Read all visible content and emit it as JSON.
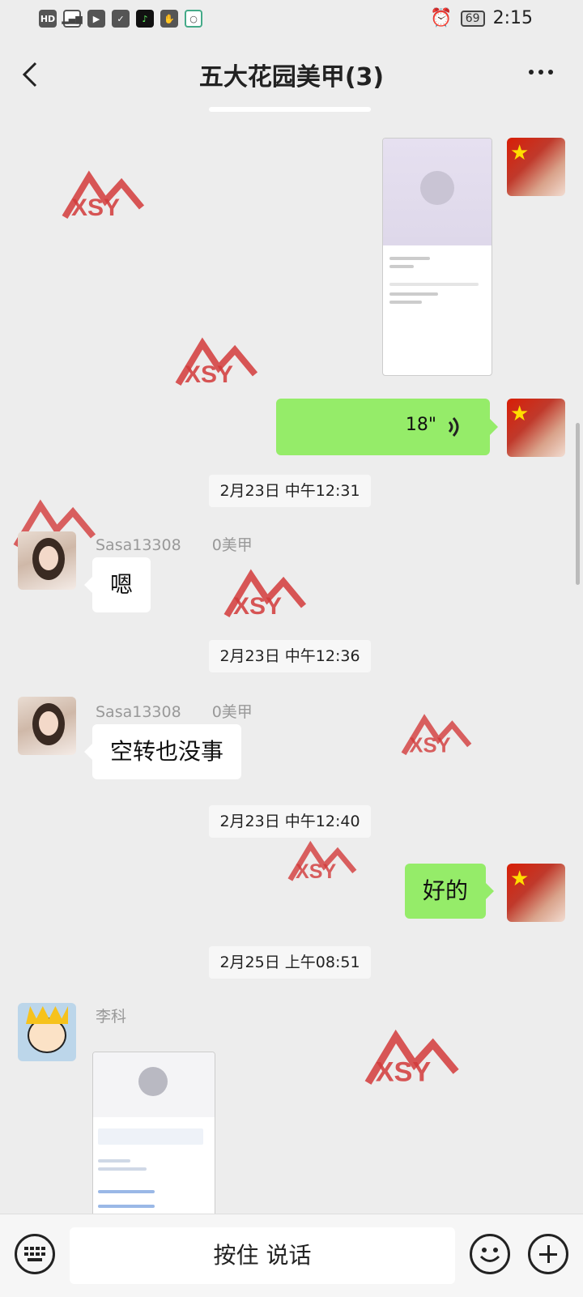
{
  "status": {
    "left_icons": [
      "HD",
      "4G",
      "signal",
      "app-1",
      "shield",
      "app-2",
      "hand",
      "chat"
    ],
    "battery": "69",
    "time": "2:15"
  },
  "header": {
    "title": "五大花园美甲(3)"
  },
  "messages": {
    "voice_duration": "18\"",
    "times": [
      "2月23日 中午12:31",
      "2月23日 中午12:36",
      "2月23日 中午12:40",
      "2月25日 上午08:51"
    ],
    "sasa_name": "Sasa13308",
    "sasa_name_suffix": "0美甲",
    "text_1": "嗯",
    "text_2": "空转也没事",
    "text_3": "好的",
    "like_name": "李科"
  },
  "watermark": "XSY",
  "bottom": {
    "talk_label": "按住 说话"
  },
  "colors": {
    "bubble_me": "#95ec69",
    "background": "#ededed"
  }
}
